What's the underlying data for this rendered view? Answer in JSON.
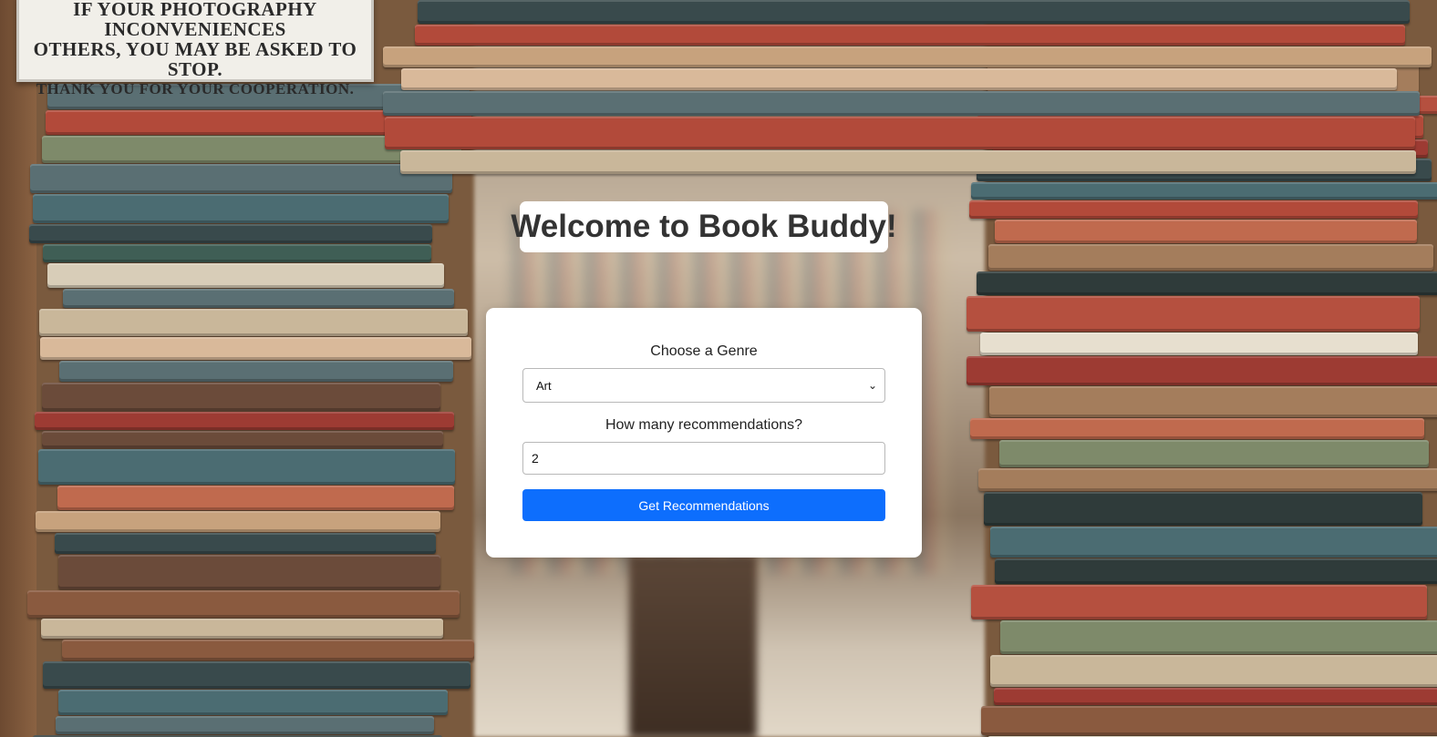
{
  "background": {
    "description_icon": "bookstore-background-image",
    "sign_lines": [
      "IF YOUR PHOTOGRAPHY INCONVENIENCES",
      "OTHERS, YOU MAY BE ASKED TO STOP.",
      "THANK YOU FOR YOUR COOPERATION."
    ]
  },
  "header": {
    "title": "Welcome to Book Buddy!"
  },
  "form": {
    "genre_label": "Choose a Genre",
    "genre_selected": "Art",
    "count_label": "How many recommendations?",
    "count_value": "2",
    "submit_label": "Get Recommendations"
  },
  "colors": {
    "accent": "#0d6efd",
    "title_text": "#333333"
  }
}
